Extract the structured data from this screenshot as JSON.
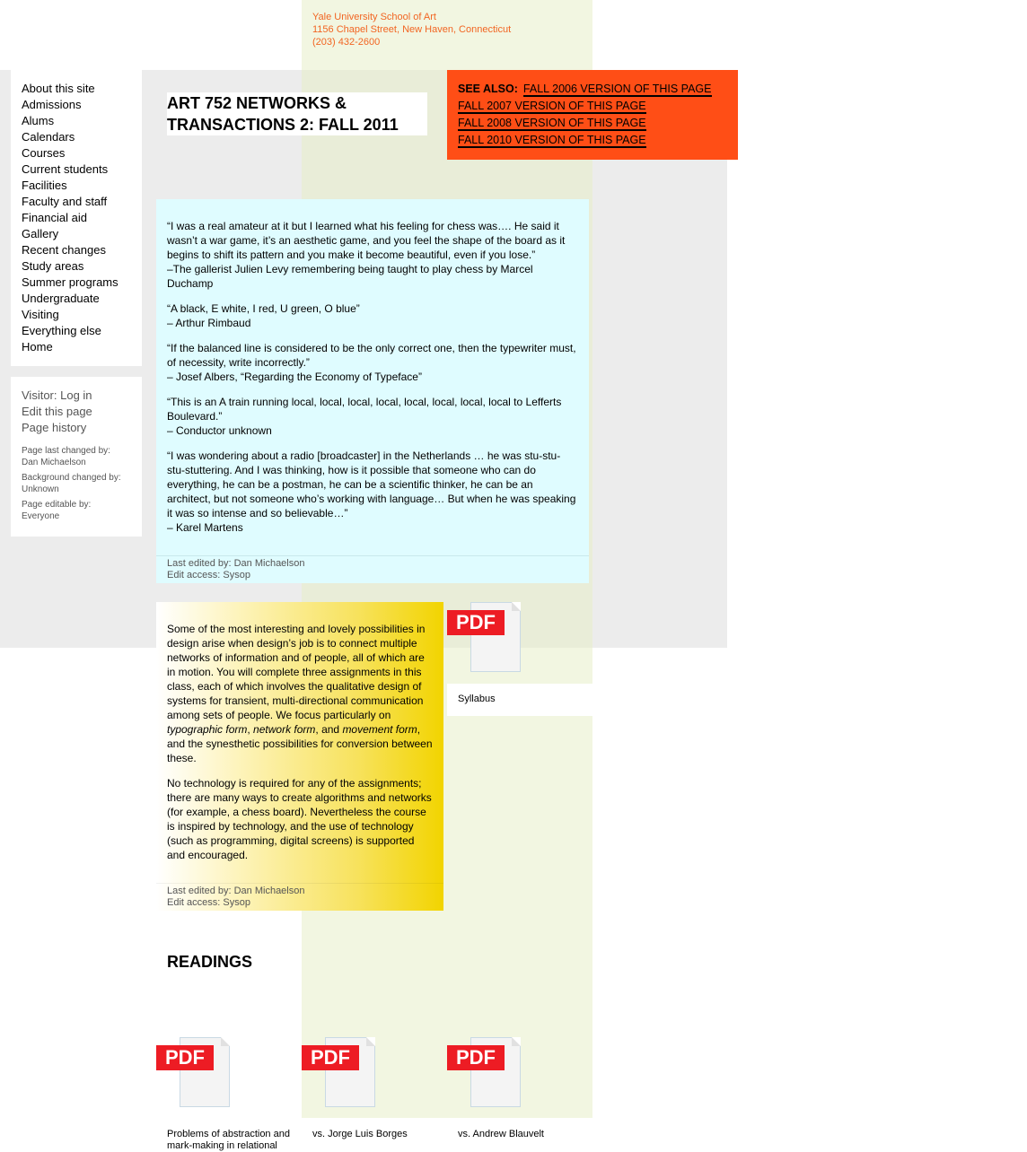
{
  "header": {
    "school": "Yale University School of Art",
    "street": "1156 Chapel Street, New Haven, Connecticut",
    "phone": "(203) 432-2600"
  },
  "nav": {
    "items": [
      "About this site",
      "Admissions",
      "Alums",
      "Calendars",
      "Courses",
      "Current students",
      "Facilities",
      "Faculty and staff",
      "Financial aid",
      "Gallery",
      "Recent changes",
      "Study areas",
      "Summer programs",
      "Undergraduate",
      "Visiting",
      "Everything else",
      "Home"
    ]
  },
  "user": {
    "login": "Visitor: Log in",
    "edit": "Edit this page",
    "history": "Page history",
    "last_changed_label": "Page last changed by:",
    "last_changed_by": "Dan Michaelson",
    "bg_changed_label": "Background changed by:",
    "bg_changed_by": "Unknown",
    "editable_label": "Page editable by:",
    "editable_by": "Everyone"
  },
  "page": {
    "title": "ART 752 NETWORKS & TRANSACTIONS 2: FALL 2011"
  },
  "see_also": {
    "label": "SEE ALSO:",
    "links": [
      "FALL 2006 VERSION OF THIS PAGE",
      "FALL 2007 VERSION OF THIS PAGE",
      "FALL 2008 VERSION OF THIS PAGE",
      "FALL 2010 VERSION OF THIS PAGE"
    ]
  },
  "quotes": {
    "q1": "“I was a real amateur at it but I learned what his feeling for chess was…. He said it wasn’t a war game, it’s an aesthetic game, and you feel the shape of the board as it begins to shift its pattern and you make it become beautiful, even if you lose.”",
    "q1_attr": "–The gallerist Julien Levy remembering being taught to play chess by Marcel Duchamp",
    "q2": "“A black, E white, I red, U green, O blue”",
    "q2_attr": "– Arthur Rimbaud",
    "q3": "“If the balanced line is considered to be the only correct one, then the typewriter must, of necessity, write incorrectly.”",
    "q3_attr": "– Josef Albers, “Regarding the Economy of Typeface”",
    "q4": "“This is an A train running local, local, local, local, local, local, local, local to Lefferts Boulevard.”",
    "q4_attr": "– Conductor unknown",
    "q5": "“I was wondering about a radio [broadcaster] in the Netherlands … he was stu-stu-stu-stuttering. And I was thinking, how is it possible that someone who can do everything, he can be a postman, he can be a scientific thinker, he can be an architect, but not someone who’s working with language… But when he was speaking it was so intense and so believable…”",
    "q5_attr": "– Karel Martens",
    "edited_by": "Last edited by: Dan Michaelson",
    "access": "Edit access: Sysop"
  },
  "description": {
    "p1_a": "Some of the most interesting and lovely possibilities in design arise when design’s job is to connect multiple networks of information and of people, all of which are in motion. You will complete three assignments in this class, each of which involves the qualitative design of systems for transient, multi-directional communication among sets of people. We focus particularly on ",
    "p1_em1": "typographic form",
    "p1_sep1": ", ",
    "p1_em2": "network form",
    "p1_sep2": ", and ",
    "p1_em3": "movement form",
    "p1_b": ", and the synesthetic possibilities for conversion between these.",
    "p2": "No technology is required for any of the assignments; there are many ways to create algorithms and networks (for example, a chess board). Nevertheless the course is inspired by technology, and the use of technology (such as programming, digital screens) is supported and encouraged.",
    "edited_by": "Last edited by: Dan Michaelson",
    "access": "Edit access: Sysop"
  },
  "syllabus": {
    "pdf": "PDF",
    "caption": "Syllabus"
  },
  "readings": {
    "heading": "READINGS",
    "items": [
      {
        "pdf": "PDF",
        "caption": "Problems of abstraction and mark-making in relational"
      },
      {
        "pdf": "PDF",
        "caption": "vs. Jorge Luis Borges"
      },
      {
        "pdf": "PDF",
        "caption": "vs. Andrew Blauvelt"
      }
    ]
  },
  "colors": {
    "accent_orange": "#ff4e16",
    "address_orange": "#f26522",
    "quote_bg": "#dffcff",
    "desc_yellow": "#f2d400",
    "pdf_red": "#ed1c24"
  }
}
